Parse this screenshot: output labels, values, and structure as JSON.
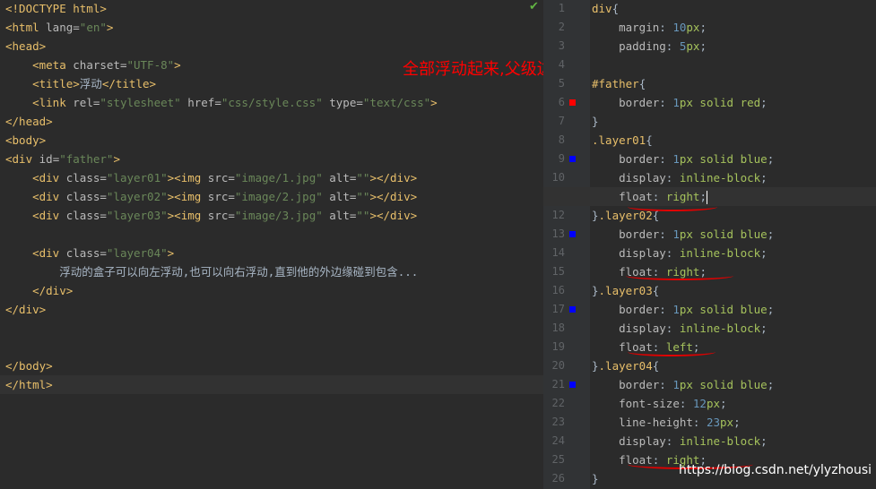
{
  "left": {
    "lines": [
      {
        "parts": [
          {
            "c": "tag",
            "t": "<!DOCTYPE html>"
          }
        ]
      },
      {
        "parts": [
          {
            "c": "tag",
            "t": "<html "
          },
          {
            "c": "attr",
            "t": "lang="
          },
          {
            "c": "str",
            "t": "\"en\""
          },
          {
            "c": "tag",
            "t": ">"
          }
        ]
      },
      {
        "parts": [
          {
            "c": "tag",
            "t": "<head>"
          }
        ]
      },
      {
        "parts": [
          {
            "c": "text",
            "t": "    "
          },
          {
            "c": "tag",
            "t": "<meta "
          },
          {
            "c": "attr",
            "t": "charset="
          },
          {
            "c": "str",
            "t": "\"UTF-8\""
          },
          {
            "c": "tag",
            "t": ">"
          }
        ]
      },
      {
        "parts": [
          {
            "c": "text",
            "t": "    "
          },
          {
            "c": "tag",
            "t": "<title>"
          },
          {
            "c": "text",
            "t": "浮动"
          },
          {
            "c": "tag",
            "t": "</title>"
          }
        ]
      },
      {
        "parts": [
          {
            "c": "text",
            "t": "    "
          },
          {
            "c": "tag",
            "t": "<link "
          },
          {
            "c": "attr",
            "t": "rel="
          },
          {
            "c": "str",
            "t": "\"stylesheet\""
          },
          {
            "c": "attr",
            "t": " href="
          },
          {
            "c": "str",
            "t": "\"css/style.css\""
          },
          {
            "c": "attr",
            "t": " type="
          },
          {
            "c": "str",
            "t": "\"text/css\""
          },
          {
            "c": "tag",
            "t": ">"
          }
        ]
      },
      {
        "parts": [
          {
            "c": "tag",
            "t": "</head>"
          }
        ]
      },
      {
        "parts": [
          {
            "c": "tag",
            "t": "<body>"
          }
        ]
      },
      {
        "parts": [
          {
            "c": "tag",
            "t": "<div "
          },
          {
            "c": "attr",
            "t": "id="
          },
          {
            "c": "str",
            "t": "\"father\""
          },
          {
            "c": "tag",
            "t": ">"
          }
        ]
      },
      {
        "parts": [
          {
            "c": "text",
            "t": "    "
          },
          {
            "c": "tag",
            "t": "<div "
          },
          {
            "c": "attr",
            "t": "class="
          },
          {
            "c": "str",
            "t": "\"layer01\""
          },
          {
            "c": "tag",
            "t": "><img "
          },
          {
            "c": "attr",
            "t": "src="
          },
          {
            "c": "str",
            "t": "\"image/1.jpg\""
          },
          {
            "c": "attr",
            "t": " alt="
          },
          {
            "c": "str",
            "t": "\"\""
          },
          {
            "c": "tag",
            "t": "></div>"
          }
        ]
      },
      {
        "parts": [
          {
            "c": "text",
            "t": "    "
          },
          {
            "c": "tag",
            "t": "<div "
          },
          {
            "c": "attr",
            "t": "class="
          },
          {
            "c": "str",
            "t": "\"layer02\""
          },
          {
            "c": "tag",
            "t": "><img "
          },
          {
            "c": "attr",
            "t": "src="
          },
          {
            "c": "str",
            "t": "\"image/2.jpg\""
          },
          {
            "c": "attr",
            "t": " alt="
          },
          {
            "c": "str",
            "t": "\"\""
          },
          {
            "c": "tag",
            "t": "></div>"
          }
        ]
      },
      {
        "parts": [
          {
            "c": "text",
            "t": "    "
          },
          {
            "c": "tag",
            "t": "<div "
          },
          {
            "c": "attr",
            "t": "class="
          },
          {
            "c": "str",
            "t": "\"layer03\""
          },
          {
            "c": "tag",
            "t": "><img "
          },
          {
            "c": "attr",
            "t": "src="
          },
          {
            "c": "str",
            "t": "\"image/3.jpg\""
          },
          {
            "c": "attr",
            "t": " alt="
          },
          {
            "c": "str",
            "t": "\"\""
          },
          {
            "c": "tag",
            "t": "></div>"
          }
        ]
      },
      {
        "parts": []
      },
      {
        "parts": [
          {
            "c": "text",
            "t": "    "
          },
          {
            "c": "tag",
            "t": "<div "
          },
          {
            "c": "attr",
            "t": "class="
          },
          {
            "c": "str",
            "t": "\"layer04\""
          },
          {
            "c": "tag",
            "t": ">"
          }
        ]
      },
      {
        "parts": [
          {
            "c": "text",
            "t": "        浮动的盒子可以向左浮动,也可以向右浮动,直到他的外边缘碰到包含..."
          }
        ]
      },
      {
        "parts": [
          {
            "c": "text",
            "t": "    "
          },
          {
            "c": "tag",
            "t": "</div>"
          }
        ]
      },
      {
        "parts": [
          {
            "c": "tag",
            "t": "</div>"
          }
        ]
      },
      {
        "parts": []
      },
      {
        "parts": []
      },
      {
        "parts": [
          {
            "c": "tag",
            "t": "</body>"
          }
        ]
      },
      {
        "parts": [
          {
            "c": "tag",
            "t": "</html>"
          }
        ]
      }
    ]
  },
  "right": {
    "lines": [
      {
        "n": "1",
        "parts": [
          {
            "c": "sel",
            "t": "div"
          },
          {
            "c": "text",
            "t": "{"
          }
        ]
      },
      {
        "n": "2",
        "parts": [
          {
            "c": "text",
            "t": "    "
          },
          {
            "c": "prop",
            "t": "margin"
          },
          {
            "c": "text",
            "t": ": "
          },
          {
            "c": "num",
            "t": "10"
          },
          {
            "c": "kw",
            "t": "px"
          },
          {
            "c": "text",
            "t": ";"
          }
        ]
      },
      {
        "n": "3",
        "parts": [
          {
            "c": "text",
            "t": "    "
          },
          {
            "c": "prop",
            "t": "padding"
          },
          {
            "c": "text",
            "t": ": "
          },
          {
            "c": "num",
            "t": "5"
          },
          {
            "c": "kw",
            "t": "px"
          },
          {
            "c": "text",
            "t": ";"
          }
        ]
      },
      {
        "n": "4",
        "parts": []
      },
      {
        "n": "5",
        "parts": [
          {
            "c": "sel",
            "t": "#father"
          },
          {
            "c": "text",
            "t": "{"
          }
        ]
      },
      {
        "n": "6",
        "marker": "#ff0000",
        "parts": [
          {
            "c": "text",
            "t": "    "
          },
          {
            "c": "prop",
            "t": "border"
          },
          {
            "c": "text",
            "t": ": "
          },
          {
            "c": "num",
            "t": "1"
          },
          {
            "c": "kw",
            "t": "px solid red"
          },
          {
            "c": "text",
            "t": ";"
          }
        ]
      },
      {
        "n": "7",
        "parts": [
          {
            "c": "text",
            "t": "}"
          }
        ]
      },
      {
        "n": "8",
        "parts": [
          {
            "c": "sel",
            "t": ".layer01"
          },
          {
            "c": "text",
            "t": "{"
          }
        ]
      },
      {
        "n": "9",
        "marker": "#0000ff",
        "parts": [
          {
            "c": "text",
            "t": "    "
          },
          {
            "c": "prop",
            "t": "border"
          },
          {
            "c": "text",
            "t": ": "
          },
          {
            "c": "num",
            "t": "1"
          },
          {
            "c": "kw",
            "t": "px solid blue"
          },
          {
            "c": "text",
            "t": ";"
          }
        ]
      },
      {
        "n": "10",
        "parts": [
          {
            "c": "text",
            "t": "    "
          },
          {
            "c": "prop",
            "t": "display"
          },
          {
            "c": "text",
            "t": ": "
          },
          {
            "c": "kw",
            "t": "inline-block"
          },
          {
            "c": "text",
            "t": ";"
          }
        ]
      },
      {
        "n": "11",
        "current": true,
        "parts": [
          {
            "c": "text",
            "t": "    "
          },
          {
            "c": "prop",
            "t": "float"
          },
          {
            "c": "text",
            "t": ": "
          },
          {
            "c": "kw",
            "t": "right"
          },
          {
            "c": "text",
            "t": ";"
          }
        ]
      },
      {
        "n": "12",
        "parts": [
          {
            "c": "text",
            "t": "}"
          },
          {
            "c": "sel",
            "t": ".layer02"
          },
          {
            "c": "text",
            "t": "{"
          }
        ]
      },
      {
        "n": "13",
        "marker": "#0000ff",
        "parts": [
          {
            "c": "text",
            "t": "    "
          },
          {
            "c": "prop",
            "t": "border"
          },
          {
            "c": "text",
            "t": ": "
          },
          {
            "c": "num",
            "t": "1"
          },
          {
            "c": "kw",
            "t": "px solid blue"
          },
          {
            "c": "text",
            "t": ";"
          }
        ]
      },
      {
        "n": "14",
        "parts": [
          {
            "c": "text",
            "t": "    "
          },
          {
            "c": "prop",
            "t": "display"
          },
          {
            "c": "text",
            "t": ": "
          },
          {
            "c": "kw",
            "t": "inline-block"
          },
          {
            "c": "text",
            "t": ";"
          }
        ]
      },
      {
        "n": "15",
        "parts": [
          {
            "c": "text",
            "t": "    "
          },
          {
            "c": "prop",
            "t": "float"
          },
          {
            "c": "text",
            "t": ": "
          },
          {
            "c": "kw",
            "t": "right"
          },
          {
            "c": "text",
            "t": ";"
          }
        ]
      },
      {
        "n": "16",
        "parts": [
          {
            "c": "text",
            "t": "}"
          },
          {
            "c": "sel",
            "t": ".layer03"
          },
          {
            "c": "text",
            "t": "{"
          }
        ]
      },
      {
        "n": "17",
        "marker": "#0000ff",
        "parts": [
          {
            "c": "text",
            "t": "    "
          },
          {
            "c": "prop",
            "t": "border"
          },
          {
            "c": "text",
            "t": ": "
          },
          {
            "c": "num",
            "t": "1"
          },
          {
            "c": "kw",
            "t": "px solid blue"
          },
          {
            "c": "text",
            "t": ";"
          }
        ]
      },
      {
        "n": "18",
        "parts": [
          {
            "c": "text",
            "t": "    "
          },
          {
            "c": "prop",
            "t": "display"
          },
          {
            "c": "text",
            "t": ": "
          },
          {
            "c": "kw",
            "t": "inline-block"
          },
          {
            "c": "text",
            "t": ";"
          }
        ]
      },
      {
        "n": "19",
        "parts": [
          {
            "c": "text",
            "t": "    "
          },
          {
            "c": "prop",
            "t": "float"
          },
          {
            "c": "text",
            "t": ": "
          },
          {
            "c": "kw",
            "t": "left"
          },
          {
            "c": "text",
            "t": ";"
          }
        ]
      },
      {
        "n": "20",
        "parts": [
          {
            "c": "text",
            "t": "}"
          },
          {
            "c": "sel",
            "t": ".layer04"
          },
          {
            "c": "text",
            "t": "{"
          }
        ]
      },
      {
        "n": "21",
        "marker": "#0000ff",
        "parts": [
          {
            "c": "text",
            "t": "    "
          },
          {
            "c": "prop",
            "t": "border"
          },
          {
            "c": "text",
            "t": ": "
          },
          {
            "c": "num",
            "t": "1"
          },
          {
            "c": "kw",
            "t": "px solid blue"
          },
          {
            "c": "text",
            "t": ";"
          }
        ]
      },
      {
        "n": "22",
        "parts": [
          {
            "c": "text",
            "t": "    "
          },
          {
            "c": "prop",
            "t": "font-size"
          },
          {
            "c": "text",
            "t": ": "
          },
          {
            "c": "num",
            "t": "12"
          },
          {
            "c": "kw",
            "t": "px"
          },
          {
            "c": "text",
            "t": ";"
          }
        ]
      },
      {
        "n": "23",
        "parts": [
          {
            "c": "text",
            "t": "    "
          },
          {
            "c": "prop",
            "t": "line-height"
          },
          {
            "c": "text",
            "t": ": "
          },
          {
            "c": "num",
            "t": "23"
          },
          {
            "c": "kw",
            "t": "px"
          },
          {
            "c": "text",
            "t": ";"
          }
        ]
      },
      {
        "n": "24",
        "parts": [
          {
            "c": "text",
            "t": "    "
          },
          {
            "c": "prop",
            "t": "display"
          },
          {
            "c": "text",
            "t": ": "
          },
          {
            "c": "kw",
            "t": "inline-block"
          },
          {
            "c": "text",
            "t": ";"
          }
        ]
      },
      {
        "n": "25",
        "parts": [
          {
            "c": "text",
            "t": "    "
          },
          {
            "c": "prop",
            "t": "float"
          },
          {
            "c": "text",
            "t": ": "
          },
          {
            "c": "kw",
            "t": "right"
          },
          {
            "c": "text",
            "t": ";"
          }
        ]
      },
      {
        "n": "26",
        "parts": [
          {
            "c": "text",
            "t": "}"
          }
        ]
      }
    ]
  },
  "annotation": "全部浮动起来,父级边框塌陷",
  "watermark": "https://blog.csdn.net/ylyzhousi",
  "check_icon": "check-icon",
  "colors": {
    "annotation": "#ff0000",
    "underline": "#e00000",
    "red_marker": "#ff0000",
    "blue_marker": "#0000ff",
    "check": "#62b543"
  }
}
